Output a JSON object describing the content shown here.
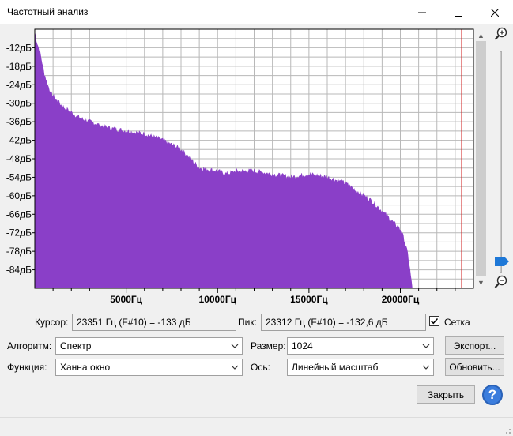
{
  "window": {
    "title": "Частотный анализ"
  },
  "chart_data": {
    "type": "area",
    "title": "",
    "xlabel": "",
    "ylabel": "",
    "xlim": [
      0,
      24000
    ],
    "ylim": [
      -90,
      -6
    ],
    "grid": true,
    "color": "#8a3fc8",
    "y_tick_labels": [
      "-12дБ",
      "-18дБ",
      "-24дБ",
      "-30дБ",
      "-36дБ",
      "-42дБ",
      "-48дБ",
      "-54дБ",
      "-60дБ",
      "-66дБ",
      "-72дБ",
      "-78дБ",
      "-84дБ"
    ],
    "y_ticks": [
      -12,
      -18,
      -24,
      -30,
      -36,
      -42,
      -48,
      -54,
      -60,
      -66,
      -72,
      -78,
      -84
    ],
    "x_tick_labels": [
      "5000Гц",
      "10000Гц",
      "15000Гц",
      "20000Гц"
    ],
    "x_ticks": [
      5000,
      10000,
      15000,
      20000
    ],
    "cursor_x": 23351,
    "series": [
      {
        "x": [
          0,
          100,
          300,
          500,
          700,
          900,
          1200,
          1500,
          2000,
          2500,
          3000,
          3500,
          4000,
          5000,
          6000,
          7000,
          8000,
          9000,
          10000,
          10500,
          11000,
          12000,
          13000,
          14000,
          15000,
          16000,
          17000,
          17500,
          18000,
          18500,
          19000,
          19500,
          20000,
          20200,
          20400,
          20500,
          20600,
          20650
        ],
        "y": [
          -7,
          -10,
          -14,
          -20,
          -24,
          -27,
          -29,
          -31,
          -33,
          -35,
          -36,
          -37,
          -38,
          -39,
          -40,
          -42,
          -45,
          -51,
          -52,
          -53,
          -52,
          -52,
          -53,
          -54,
          -53,
          -54,
          -56,
          -58,
          -60,
          -62,
          -65,
          -68,
          -71,
          -74,
          -79,
          -83,
          -88,
          -90
        ]
      }
    ]
  },
  "cursor": {
    "label": "Курсор:",
    "value": "23351 Гц (F#10) = -133 дБ"
  },
  "peak": {
    "label": "Пик:",
    "value": "23312 Гц (F#10) = -132,6 дБ"
  },
  "grid_toggle": {
    "label": "Сетка",
    "checked": "true"
  },
  "algorithm": {
    "label": "Алгоритм:",
    "value": "Спектр"
  },
  "size": {
    "label": "Размер:",
    "value": "1024"
  },
  "function": {
    "label": "Функция:",
    "value": "Ханна  окно"
  },
  "axis": {
    "label": "Ось:",
    "value": "Линейный масштаб"
  },
  "buttons": {
    "export": "Экспорт...",
    "refresh": "Обновить...",
    "close": "Закрыть",
    "help": "?"
  }
}
